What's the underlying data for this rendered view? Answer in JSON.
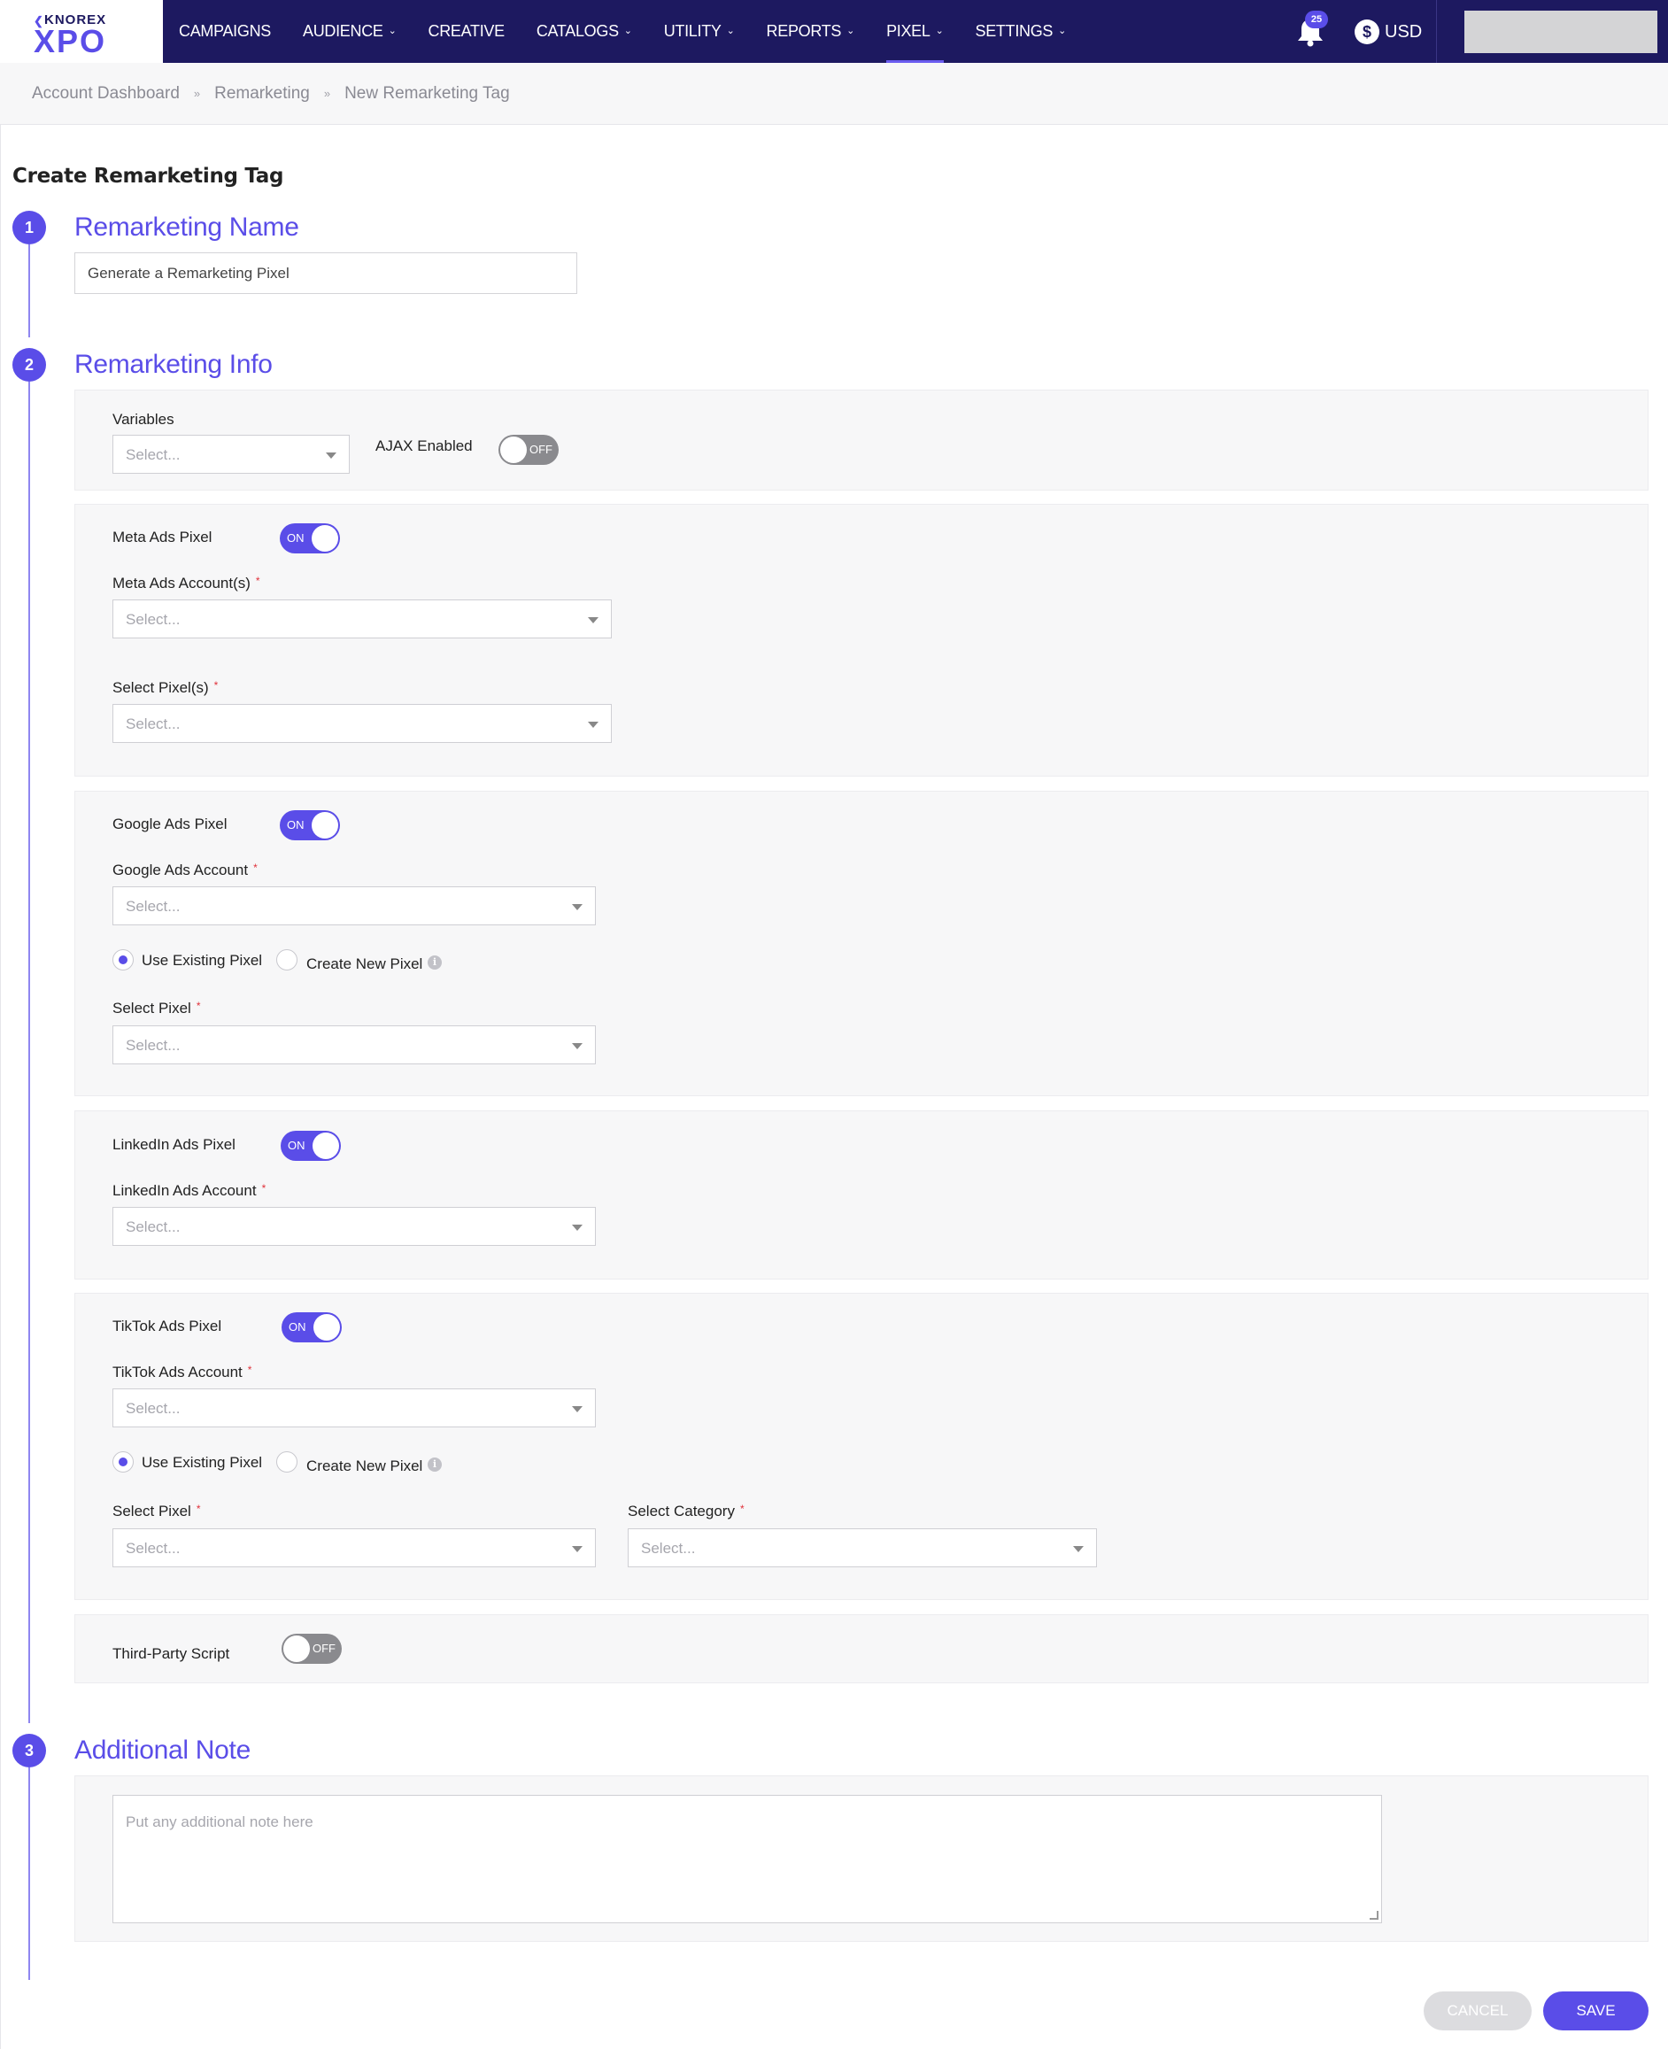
{
  "brand": {
    "company": "KNOREX",
    "product": "XPO"
  },
  "nav": {
    "items": [
      {
        "label": "CAMPAIGNS",
        "dropdown": false
      },
      {
        "label": "AUDIENCE",
        "dropdown": true
      },
      {
        "label": "CREATIVE",
        "dropdown": false
      },
      {
        "label": "CATALOGS",
        "dropdown": true
      },
      {
        "label": "UTILITY",
        "dropdown": true
      },
      {
        "label": "REPORTS",
        "dropdown": true
      },
      {
        "label": "PIXEL",
        "dropdown": true,
        "active": true
      },
      {
        "label": "SETTINGS",
        "dropdown": true
      }
    ],
    "notifications_count": "25",
    "currency_symbol": "$",
    "currency": "USD"
  },
  "breadcrumb": [
    "Account Dashboard",
    "Remarketing",
    "New Remarketing Tag"
  ],
  "page_title": "Create Remarketing Tag",
  "steps": [
    {
      "number": "1",
      "title": "Remarketing Name"
    },
    {
      "number": "2",
      "title": "Remarketing Info"
    },
    {
      "number": "3",
      "title": "Additional Note"
    }
  ],
  "name_input": {
    "value": "Generate a Remarketing Pixel"
  },
  "select_placeholder": "Select...",
  "variables": {
    "label": "Variables",
    "ajax_label": "AJAX Enabled",
    "ajax_state": "OFF"
  },
  "meta": {
    "label": "Meta Ads Pixel",
    "state": "ON",
    "account_label": "Meta Ads Account(s)",
    "pixel_label": "Select Pixel(s)"
  },
  "google": {
    "label": "Google Ads Pixel",
    "state": "ON",
    "account_label": "Google Ads Account",
    "radio_existing": "Use Existing Pixel",
    "radio_new": "Create New Pixel",
    "pixel_label": "Select Pixel"
  },
  "linkedin": {
    "label": "LinkedIn Ads Pixel",
    "state": "ON",
    "account_label": "LinkedIn Ads Account"
  },
  "tiktok": {
    "label": "TikTok Ads Pixel",
    "state": "ON",
    "account_label": "TikTok Ads Account",
    "radio_existing": "Use Existing Pixel",
    "radio_new": "Create New Pixel",
    "pixel_label": "Select Pixel",
    "category_label": "Select Category"
  },
  "third_party": {
    "label": "Third-Party Script",
    "state": "OFF"
  },
  "note": {
    "placeholder": "Put any additional note here"
  },
  "actions": {
    "cancel": "CANCEL",
    "save": "SAVE"
  },
  "colors": {
    "navbar": "#1d1960",
    "accent": "#5a4de8",
    "required": "#e0313a"
  }
}
